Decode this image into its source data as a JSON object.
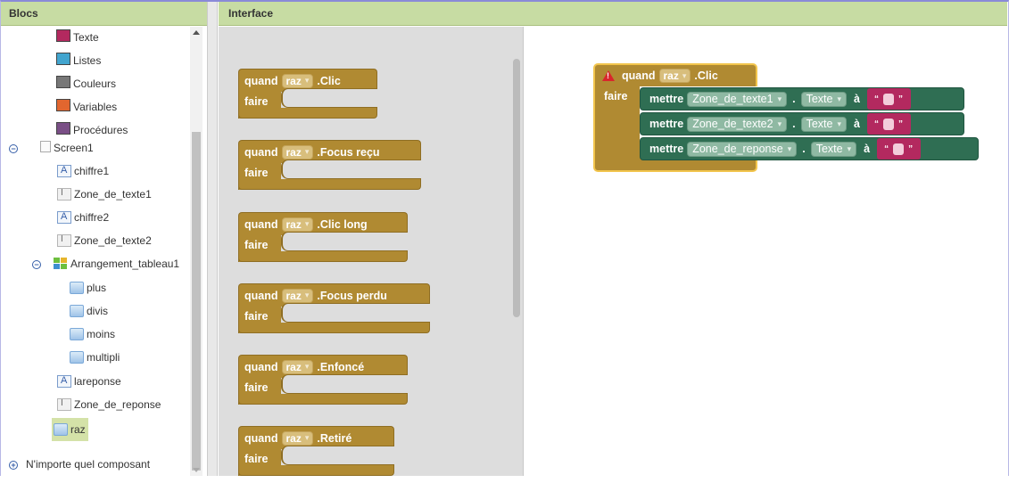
{
  "left_panel": {
    "title": "Blocs",
    "builtin": [
      {
        "label": "Texte",
        "color": "#b3295f"
      },
      {
        "label": "Listes",
        "color": "#42a5cf"
      },
      {
        "label": "Couleurs",
        "color": "#777777"
      },
      {
        "label": "Variables",
        "color": "#e2662f"
      },
      {
        "label": "Procédures",
        "color": "#7a4f86"
      }
    ],
    "screen": "Screen1",
    "components": [
      {
        "label": "chiffre1",
        "icon": "label-icon"
      },
      {
        "label": "Zone_de_texte1",
        "icon": "textbox-icon"
      },
      {
        "label": "chiffre2",
        "icon": "label-icon"
      },
      {
        "label": "Zone_de_texte2",
        "icon": "textbox-icon"
      }
    ],
    "arrangement": "Arrangement_tableau1",
    "arrangement_children": [
      "plus",
      "divis",
      "moins",
      "multipli"
    ],
    "after_components": [
      {
        "label": "lareponse",
        "icon": "label-icon"
      },
      {
        "label": "Zone_de_reponse",
        "icon": "textbox-icon"
      },
      {
        "label": "raz",
        "icon": "button-icon",
        "selected": true
      }
    ],
    "any_component": "N'importe quel composant"
  },
  "right_panel": {
    "title": "Interface",
    "flyout_blocks": [
      {
        "when": "quand",
        "component": "raz",
        "event": ".Clic",
        "do": "faire"
      },
      {
        "when": "quand",
        "component": "raz",
        "event": ".Focus reçu",
        "do": "faire"
      },
      {
        "when": "quand",
        "component": "raz",
        "event": ".Clic long",
        "do": "faire"
      },
      {
        "when": "quand",
        "component": "raz",
        "event": ".Focus perdu",
        "do": "faire"
      },
      {
        "when": "quand",
        "component": "raz",
        "event": ".Enfoncé",
        "do": "faire"
      },
      {
        "when": "quand",
        "component": "raz",
        "event": ".Retiré",
        "do": "faire"
      }
    ],
    "workspace_block": {
      "when": "quand",
      "component": "raz",
      "event": ".Clic",
      "do": "faire",
      "statements": [
        {
          "set": "mettre",
          "target": "Zone_de_texte1",
          "property": "Texte",
          "to": "à",
          "value": ""
        },
        {
          "set": "mettre",
          "target": "Zone_de_texte2",
          "property": "Texte",
          "to": "à",
          "value": ""
        },
        {
          "set": "mettre",
          "target": "Zone_de_reponse",
          "property": "Texte",
          "to": "à",
          "value": ""
        }
      ]
    }
  },
  "colors": {
    "header_bg": "#c7dca3",
    "event_block": "#b08a32",
    "setter_block": "#2f6e53",
    "text_block": "#b3295f",
    "selected_highlight": "#f2c54d"
  }
}
